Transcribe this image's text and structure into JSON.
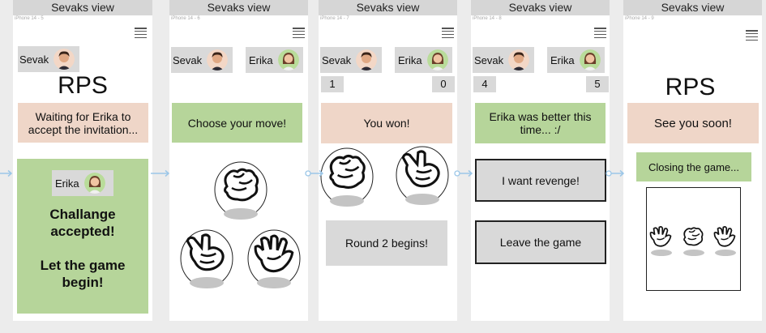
{
  "frames": [
    {
      "title": "Sevaks view",
      "subtitle": "iPhone 14 - 5",
      "player1": "Sevak",
      "heading": "RPS",
      "status": "Waiting for Erika to accept the invitation...",
      "card_player": "Erika",
      "card_text_1": "Challange accepted!",
      "card_text_2": "Let the game begin!"
    },
    {
      "title": "Sevaks view",
      "subtitle": "iPhone 14 - 6",
      "player1": "Sevak",
      "player2": "Erika",
      "status": "Choose your move!",
      "hands": [
        "rock",
        "paper",
        "scissors"
      ]
    },
    {
      "title": "Sevaks view",
      "subtitle": "iPhone 14 - 7",
      "player1": "Sevak",
      "player2": "Erika",
      "score1": "1",
      "score2": "0",
      "status": "You won!",
      "hands": [
        "rock",
        "scissors"
      ],
      "round_button": "Round 2 begins!"
    },
    {
      "title": "Sevaks view",
      "subtitle": "iPhone 14 - 8",
      "player1": "Sevak",
      "player2": "Erika",
      "score1": "4",
      "score2": "5",
      "status": "Erika was better this time... :/",
      "revenge_button": "I want revenge!",
      "leave_button": "Leave the game"
    },
    {
      "title": "Sevaks view",
      "subtitle": "iPhone 14 - 9",
      "heading": "RPS",
      "status": "See you soon!",
      "closing": "Closing the game...",
      "hands": [
        "paper",
        "rock",
        "paper"
      ]
    }
  ],
  "colors": {
    "peach": "#efd6c8",
    "green": "#b6d59a",
    "grey": "#d9d9d9",
    "connector": "#9cc7e8"
  },
  "icons": [
    "hamburger-menu-icon",
    "sevak-avatar-icon",
    "erika-avatar-icon",
    "rock-hand-icon",
    "paper-hand-icon",
    "scissors-hand-icon",
    "flow-arrow-icon"
  ]
}
